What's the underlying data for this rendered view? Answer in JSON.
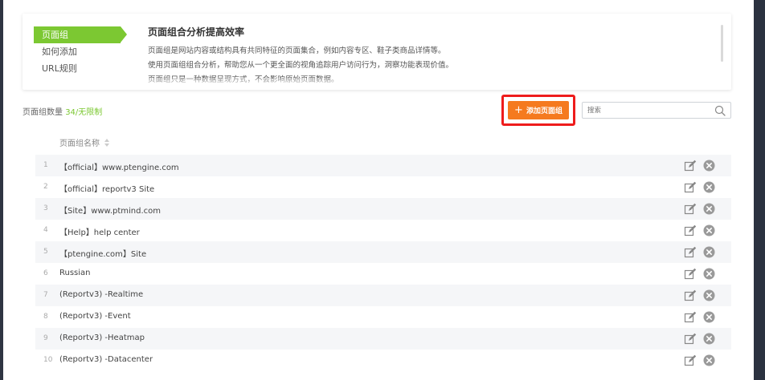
{
  "help": {
    "nav": [
      {
        "label": "页面组"
      },
      {
        "label": "如何添加"
      },
      {
        "label": "URL规则"
      }
    ],
    "title": "页面组合分析提高效率",
    "lines": [
      "页面组是网站内容或结构具有共同特征的页面集合，例如内容专区、鞋子类商品详情等。",
      "使用页面组组合分析，帮助您从一个更全面的视角追踪用户访问行为，洞察功能表现价值。",
      "页面组只是一种数据呈现方式，不会影响原始页面数据。"
    ]
  },
  "toolbar": {
    "count_label": "页面组数量",
    "count_value": "34/无限制",
    "add_label": "添加页面组",
    "search_placeholder": "搜索"
  },
  "table": {
    "column_header": "页面组名称",
    "rows": [
      {
        "index": "1",
        "name": "【official】www.ptengine.com"
      },
      {
        "index": "2",
        "name": "【official】reportv3 Site"
      },
      {
        "index": "3",
        "name": "【Site】www.ptmind.com"
      },
      {
        "index": "4",
        "name": "【Help】help center"
      },
      {
        "index": "5",
        "name": "【ptengine.com】Site"
      },
      {
        "index": "6",
        "name": "Russian"
      },
      {
        "index": "7",
        "name": "(Reportv3) -Realtime"
      },
      {
        "index": "8",
        "name": "(Reportv3) -Event"
      },
      {
        "index": "9",
        "name": "(Reportv3) -Heatmap"
      },
      {
        "index": "10",
        "name": "(Reportv3) -Datacenter"
      }
    ]
  },
  "colors": {
    "accent_green": "#7cc832",
    "add_button_orange": "#f57a1f",
    "highlight_red": "#ee1c1c"
  }
}
